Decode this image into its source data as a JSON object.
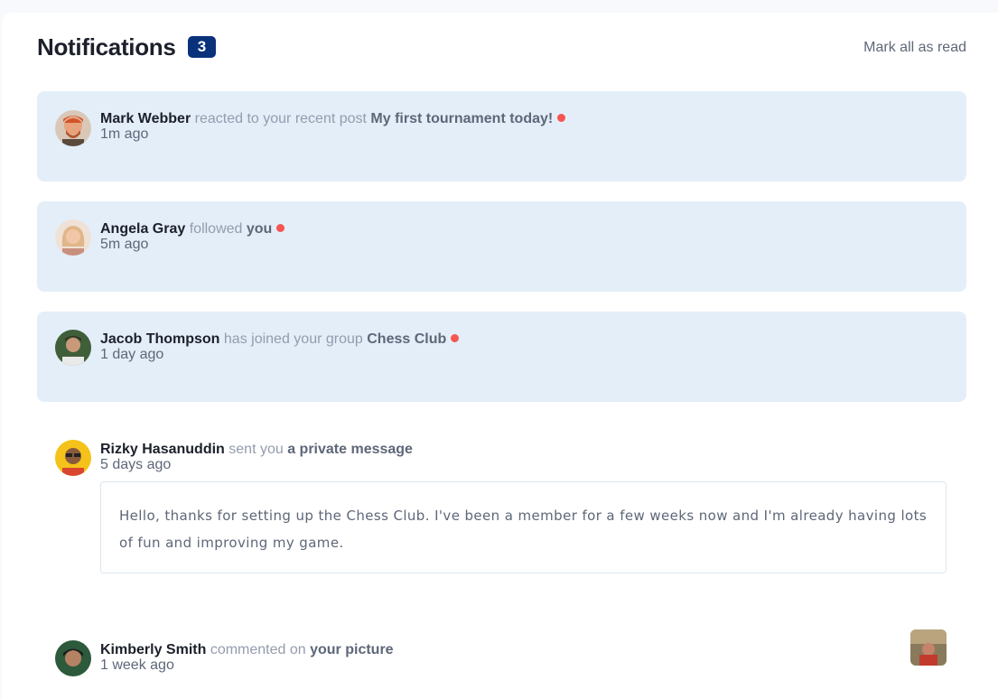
{
  "header": {
    "title": "Notifications",
    "count": "3",
    "mark_all": "Mark all as read"
  },
  "notifications": [
    {
      "name": "Mark Webber",
      "action": "reacted to your recent post",
      "target": "My first tournament today!",
      "time": "1m ago",
      "unread": true
    },
    {
      "name": "Angela Gray",
      "action": "followed",
      "target": "you",
      "time": "5m ago",
      "unread": true
    },
    {
      "name": "Jacob Thompson",
      "action": "has joined your group",
      "target": "Chess Club",
      "time": "1 day ago",
      "unread": true
    },
    {
      "name": "Rizky Hasanuddin",
      "action": "sent you",
      "target": "a private message",
      "time": "5 days ago",
      "unread": false,
      "message": "Hello, thanks for setting up the Chess Club. I've been a member for a few weeks now and I'm already having lots of fun and improving my game."
    },
    {
      "name": "Kimberly Smith",
      "action": "commented on",
      "target": "your picture",
      "time": "1 week ago",
      "unread": false
    }
  ],
  "colors": {
    "unread_bg": "#e4eef9",
    "badge": "#0a327b",
    "dot": "#f65552"
  }
}
